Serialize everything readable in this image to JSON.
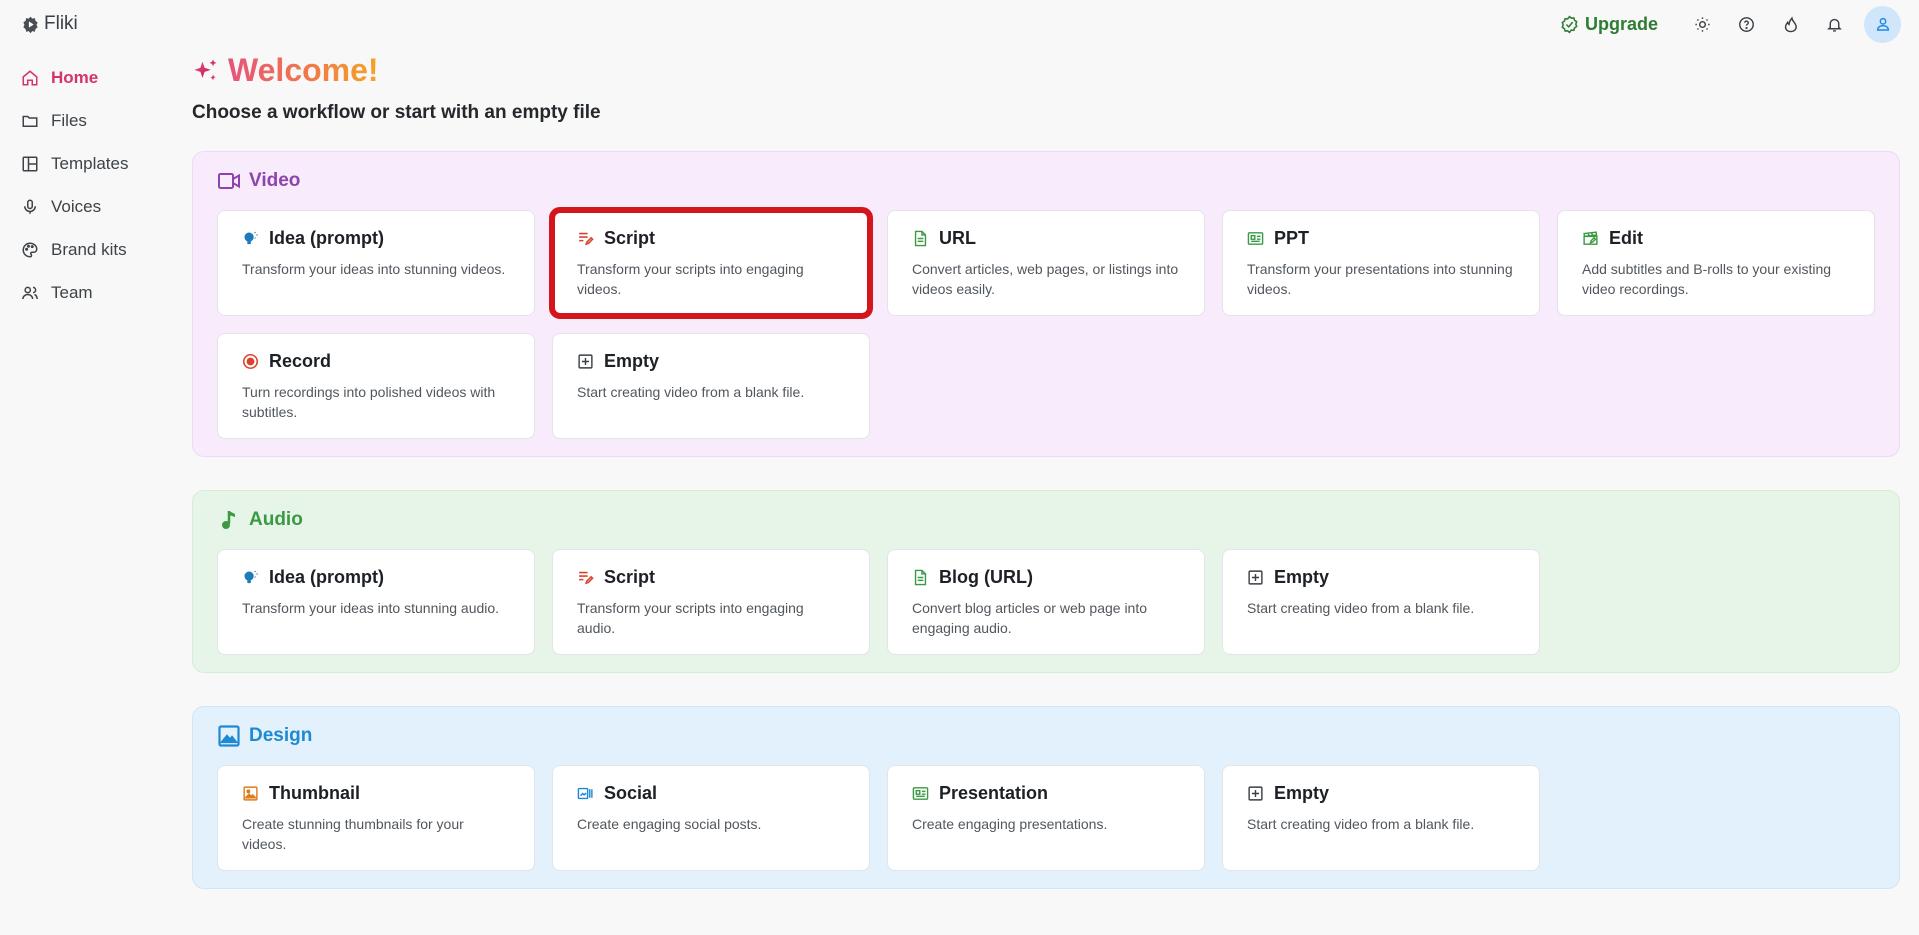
{
  "app": {
    "name": "Fliki"
  },
  "topbar": {
    "upgrade_label": "Upgrade",
    "icons": [
      "sun-icon",
      "help-icon",
      "fire-icon",
      "bell-icon",
      "user-icon"
    ]
  },
  "sidebar": {
    "items": [
      {
        "label": "Home",
        "icon": "home-icon",
        "active": true
      },
      {
        "label": "Files",
        "icon": "folder-icon"
      },
      {
        "label": "Templates",
        "icon": "layout-icon"
      },
      {
        "label": "Voices",
        "icon": "microphone-icon"
      },
      {
        "label": "Brand kits",
        "icon": "palette-icon"
      },
      {
        "label": "Team",
        "icon": "users-icon"
      }
    ]
  },
  "main": {
    "welcome": "Welcome!",
    "subtitle": "Choose a workflow or start with an empty file",
    "sections": [
      {
        "title": "Video",
        "color": "#8e44ad",
        "cards": [
          {
            "title": "Idea (prompt)",
            "desc": "Transform your ideas into stunning videos."
          },
          {
            "title": "Script",
            "desc": "Transform your scripts into engaging videos."
          },
          {
            "title": "URL",
            "desc": "Convert articles, web pages, or listings into videos easily."
          },
          {
            "title": "PPT",
            "desc": "Transform your presentations into stunning videos."
          },
          {
            "title": "Edit",
            "desc": "Add subtitles and B-rolls to your existing video recordings."
          },
          {
            "title": "Record",
            "desc": "Turn recordings into polished videos with subtitles."
          },
          {
            "title": "Empty",
            "desc": "Start creating video from a blank file."
          }
        ]
      },
      {
        "title": "Audio",
        "color": "#3a9a43",
        "cards": [
          {
            "title": "Idea (prompt)",
            "desc": "Transform your ideas into stunning audio."
          },
          {
            "title": "Script",
            "desc": "Transform your scripts into engaging audio."
          },
          {
            "title": "Blog (URL)",
            "desc": "Convert blog articles or web page into engaging audio."
          },
          {
            "title": "Empty",
            "desc": "Start creating video from a blank file."
          }
        ]
      },
      {
        "title": "Design",
        "color": "#1e8ad1",
        "cards": [
          {
            "title": "Thumbnail",
            "desc": "Create stunning thumbnails for your videos."
          },
          {
            "title": "Social",
            "desc": "Create engaging social posts."
          },
          {
            "title": "Presentation",
            "desc": "Create engaging presentations."
          },
          {
            "title": "Empty",
            "desc": "Start creating video from a blank file."
          }
        ]
      }
    ]
  }
}
